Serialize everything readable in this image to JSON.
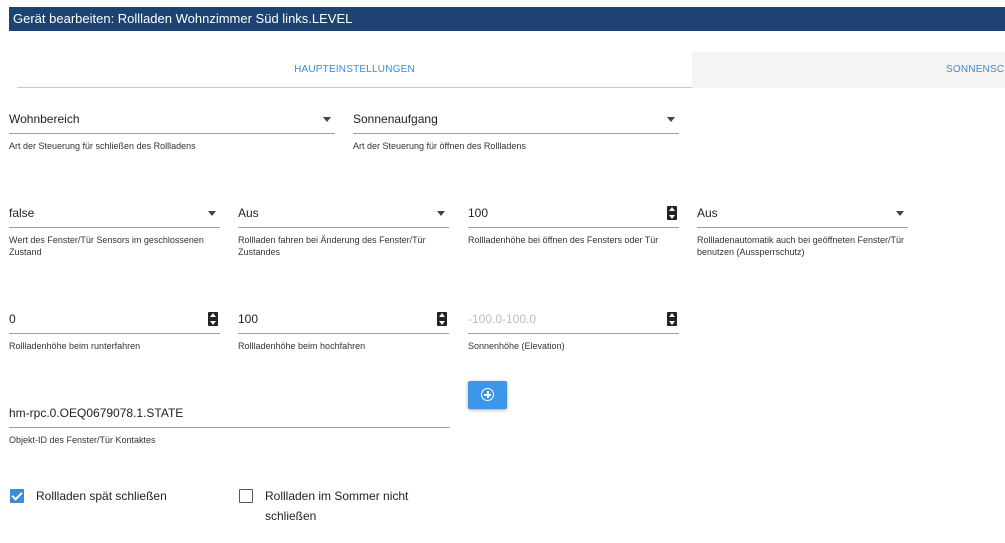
{
  "window": {
    "title": "Gerät bearbeiten: Rollladen Wohnzimmer Süd links.LEVEL"
  },
  "tabs": [
    {
      "label": "HAUPTEINSTELLUNGEN",
      "active": true
    },
    {
      "label": "SONNENSCH",
      "active": false
    }
  ],
  "fields": {
    "close_type": {
      "value": "Wohnbereich",
      "helper": "Art der Steuerung für schließen des Rollladens"
    },
    "open_type": {
      "value": "Sonnenaufgang",
      "helper": "Art der Steuerung für öffnen des Rollladens"
    },
    "sensor_closed_state": {
      "value": "false",
      "helper": "Wert des Fenster/Tür Sensors im geschlossenen Zustand"
    },
    "move_on_change": {
      "value": "Aus",
      "helper": "Rollladen fahren bei Änderung des Fenster/Tür Zustandes"
    },
    "height_on_open": {
      "value": "100",
      "helper": "Rollladenhöhe bei öffnen des Fensters oder Tür"
    },
    "lockout_protection": {
      "value": "Aus",
      "helper": "Rollladenautomatik auch bei geöffneten Fenster/Tür benutzen (Aussperrschutz)"
    },
    "height_down": {
      "value": "0",
      "helper": "Rollladenhöhe beim runterfahren"
    },
    "height_up": {
      "value": "100",
      "helper": "Rollladenhöhe beim hochfahren"
    },
    "sun_elevation": {
      "value": "",
      "placeholder": "-100.0-100.0",
      "helper": "Sonnenhöhe (Elevation)"
    },
    "contact_object_id": {
      "value": "hm-rpc.0.OEQ0679078.1.STATE",
      "helper": "Objekt-ID des Fenster/Tür Kontaktes"
    }
  },
  "checkboxes": {
    "close_late": {
      "label": "Rollladen spät schließen",
      "checked": true
    },
    "no_close_summer": {
      "label": "Rollladen im Sommer nicht schließen",
      "checked": false
    }
  },
  "colors": {
    "titlebar": "#1d4373",
    "accent": "#3c8bd4",
    "button": "#3c95e6"
  },
  "icons": {
    "add_button": "plus-circle-icon",
    "select": "chevron-down-icon",
    "number": "spinner-icon"
  }
}
